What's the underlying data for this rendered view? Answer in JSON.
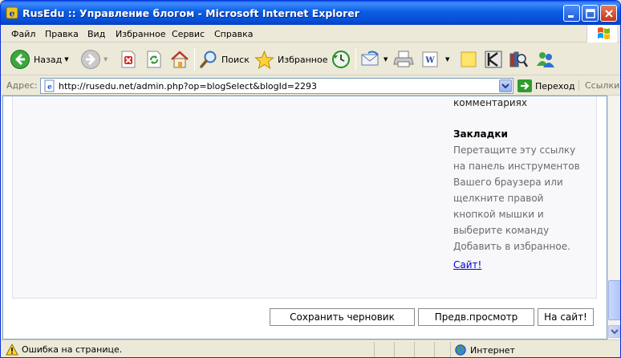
{
  "window": {
    "title": "RusEdu :: Управление блогом - Microsoft Internet Explorer"
  },
  "menu": [
    "Файл",
    "Правка",
    "Вид",
    "Избранное",
    "Сервис",
    "Справка"
  ],
  "toolbar": {
    "back_label": "Назад",
    "search_label": "Поиск",
    "favorites_label": "Избранное"
  },
  "address": {
    "label": "Адрес:",
    "url": "http://rusedu.net/admin.php?op=blogSelect&blogId=2293",
    "go_label": "Переход",
    "links_label": "Ссылки"
  },
  "sidebar": {
    "partial_line": "комментариях",
    "heading": "Закладки",
    "lines": [
      "Перетащите эту ссылку",
      "на панель инструментов",
      "Вашего браузера или",
      "щелкните правой",
      "кнопкой мышки и",
      "выберите команду",
      "Добавить в избранное."
    ],
    "link_text": "Сайт!"
  },
  "buttons": {
    "save_draft": "Сохранить черновик",
    "preview": "Предв.просмотр",
    "to_site": "На сайт!"
  },
  "status": {
    "text": "Ошибка на странице.",
    "zone": "Интернет"
  },
  "colors": {
    "titlebar": "#0a5fe8",
    "chrome": "#ece9d8",
    "link": "#0000cc"
  }
}
